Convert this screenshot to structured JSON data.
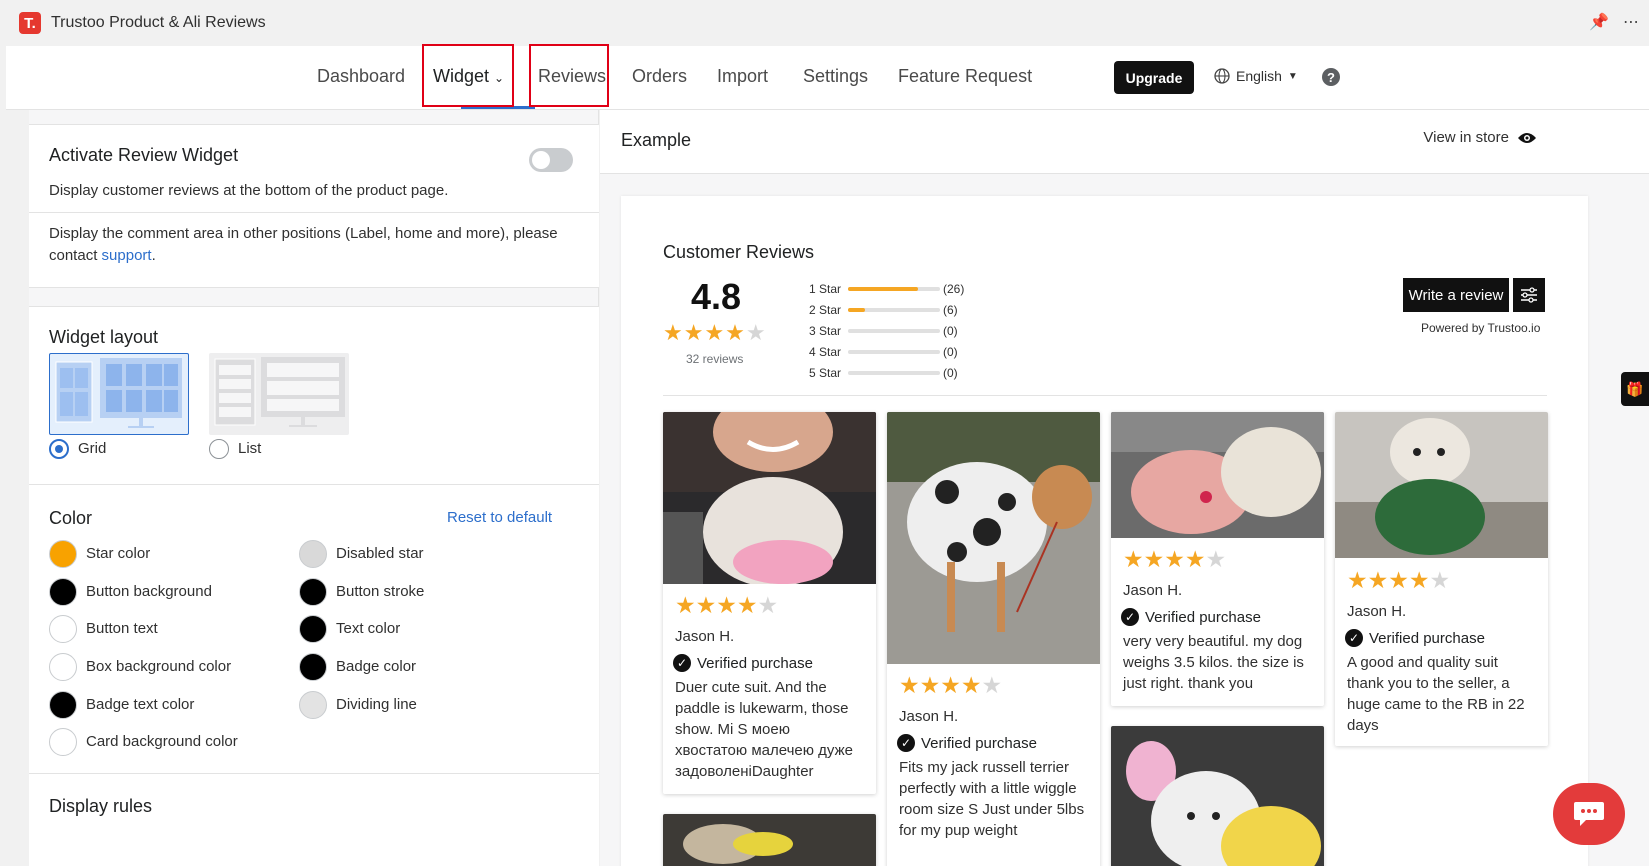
{
  "app": {
    "logo_letter": "T.",
    "title": "Trustoo Product & Ali Reviews"
  },
  "nav": {
    "items": [
      "Dashboard",
      "Widget",
      "Reviews",
      "Orders",
      "Import",
      "Settings",
      "Feature Request"
    ],
    "upgrade": "Upgrade",
    "language": "English"
  },
  "activate": {
    "title": "Activate Review Widget",
    "desc": "Display customer reviews at the bottom of the product page.",
    "other_text": "Display the comment area in other positions (Label, home and more), please contact",
    "support_link": "support",
    "period": "."
  },
  "layout": {
    "title": "Widget layout",
    "grid": "Grid",
    "list": "List"
  },
  "color": {
    "title": "Color",
    "reset": "Reset to default",
    "items_left": [
      {
        "label": "Star color",
        "color": "#f8a200"
      },
      {
        "label": "Button background",
        "color": "#000000"
      },
      {
        "label": "Button text",
        "color": "#ffffff"
      },
      {
        "label": "Box background color",
        "color": "#ffffff"
      },
      {
        "label": "Badge text color",
        "color": "#000000"
      },
      {
        "label": "Card background color",
        "color": "#ffffff"
      }
    ],
    "items_right": [
      {
        "label": "Disabled star",
        "color": "#d9d9d9"
      },
      {
        "label": "Button stroke",
        "color": "#000000"
      },
      {
        "label": "Text color",
        "color": "#000000"
      },
      {
        "label": "Badge color",
        "color": "#000000"
      },
      {
        "label": "Dividing line",
        "color": "#e3e3e3"
      }
    ]
  },
  "rules": {
    "title": "Display rules"
  },
  "preview": {
    "example": "Example",
    "view_store": "View in store",
    "heading": "Customer Reviews",
    "rating": "4.8",
    "review_count": "32 reviews",
    "distribution": [
      {
        "label": "1 Star",
        "count": "(26)",
        "fraction": 0.76
      },
      {
        "label": "2 Star",
        "count": "(6)",
        "fraction": 0.18
      },
      {
        "label": "3 Star",
        "count": "(0)",
        "fraction": 0
      },
      {
        "label": "4 Star",
        "count": "(0)",
        "fraction": 0
      },
      {
        "label": "5 Star",
        "count": "(0)",
        "fraction": 0
      }
    ],
    "write_review": "Write a review",
    "powered_by": "Powered by Trustoo.io",
    "reviews": [
      {
        "name": "Jason H.",
        "verified": "Verified purchase",
        "text": "Duer cute suit. And the paddle is lukewarm, those show. Mi S моею хвостатою малечею дуже задоволеніDaughter"
      },
      {
        "name": "Jason H.",
        "verified": "Verified purchase",
        "text": "Fits my jack russell terrier perfectly with a little wiggle room size S Just under 5lbs for my pup weight"
      },
      {
        "name": "Jason H.",
        "verified": "Verified purchase",
        "text": "very very beautiful. my dog weighs 3.5 kilos. the size is just right. thank you"
      },
      {
        "name": "Jason H.",
        "verified": "Verified purchase",
        "text": "A good and quality suit thank you to the seller, a huge came to the RB in 22 days"
      }
    ]
  }
}
